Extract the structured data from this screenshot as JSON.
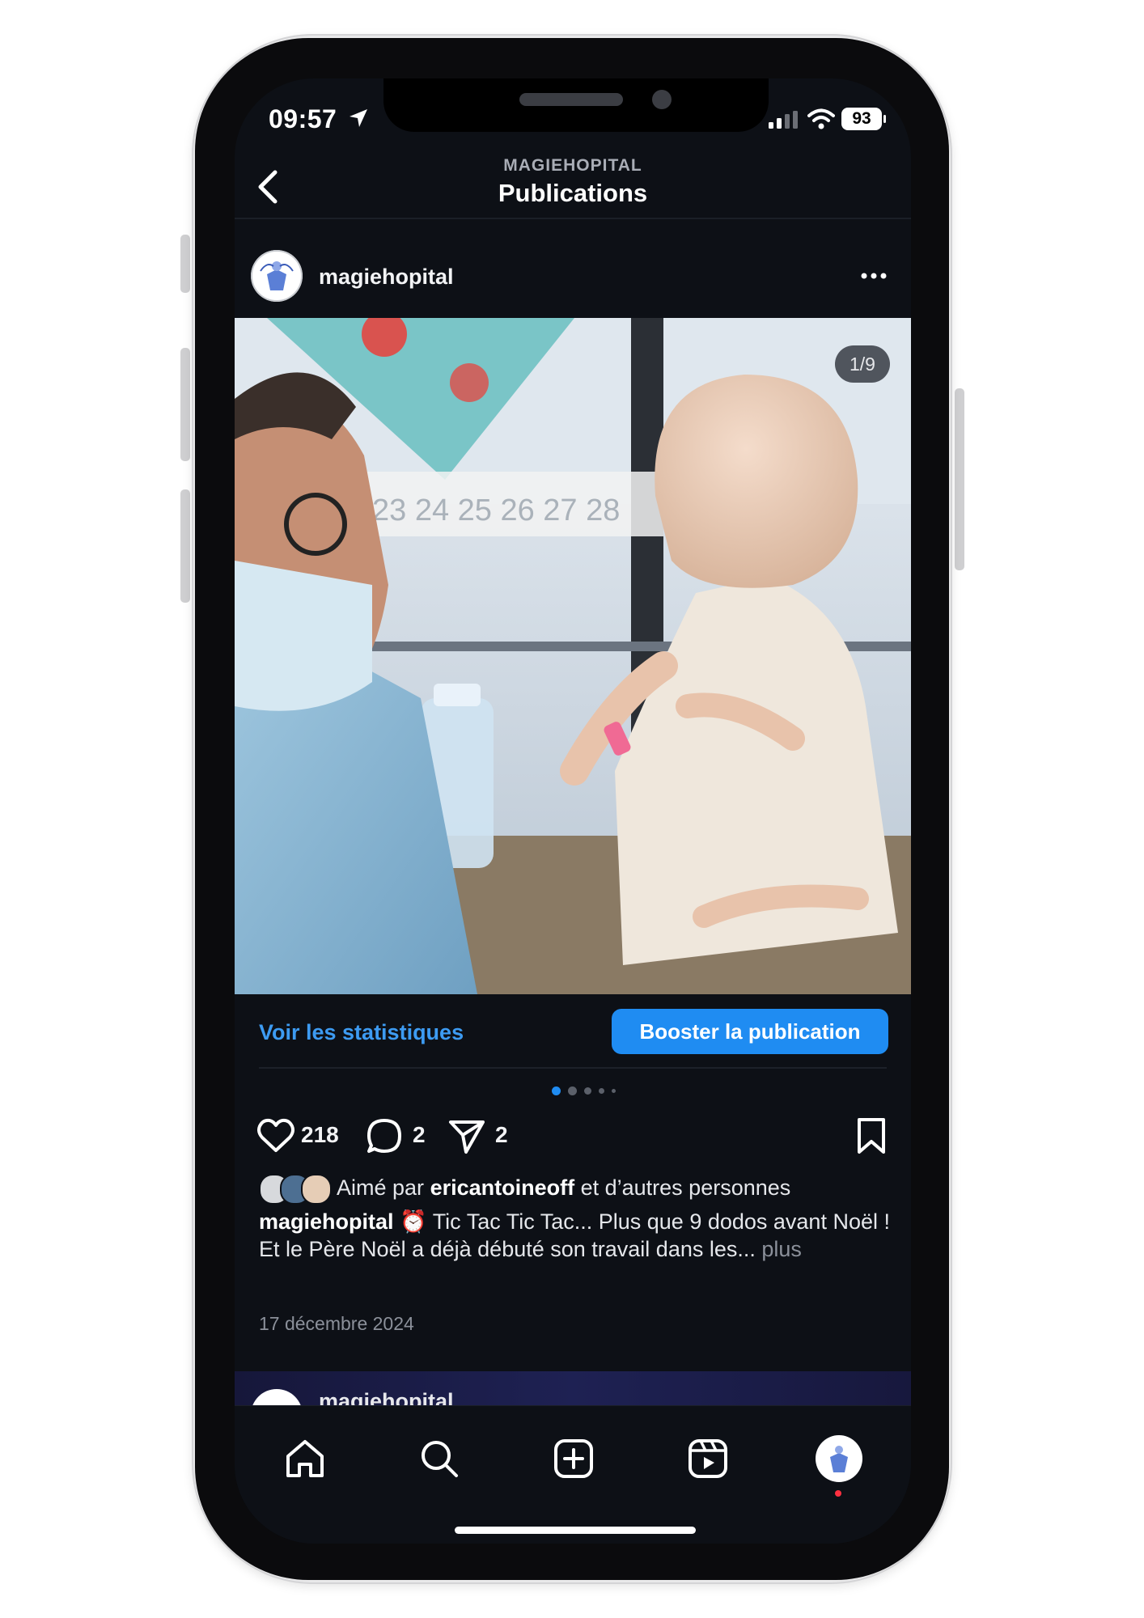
{
  "status_bar": {
    "time": "09:57",
    "battery": "93"
  },
  "header": {
    "account": "MAGIEHOPITAL",
    "title": "Publications"
  },
  "post": {
    "username": "magiehopital",
    "image_counter": "1/9",
    "stats_link": "Voir les statistiques",
    "boost_button": "Booster la publication",
    "likes": "218",
    "comments": "2",
    "shares": "2",
    "liked_prefix": "Aimé par",
    "liked_user": "ericantoineoff",
    "liked_suffix": "et d’autres personnes",
    "caption_user": "magiehopital",
    "caption_line1": "Tic Tac Tic Tac... Plus que 9 dodos avant Noël !",
    "caption_line2": "Et le Père Noël a déjà débuté son travail dans les...",
    "caption_more": "plus",
    "date": "17 décembre 2024"
  },
  "next_post": {
    "username": "magiehopital"
  },
  "icons": {
    "back": "chevron-left-icon",
    "more": "more-horizontal-icon",
    "like": "heart-icon",
    "comment": "comment-icon",
    "share": "send-icon",
    "save": "bookmark-icon",
    "home": "home-icon",
    "search": "search-icon",
    "create": "plus-square-icon",
    "reels": "reels-icon",
    "profile": "profile-avatar",
    "alarm": "alarm-clock-emoji"
  },
  "colors": {
    "accent": "#1f8cf2",
    "link": "#3d9bf2",
    "background": "#0d1016",
    "notification": "#ff3040"
  }
}
